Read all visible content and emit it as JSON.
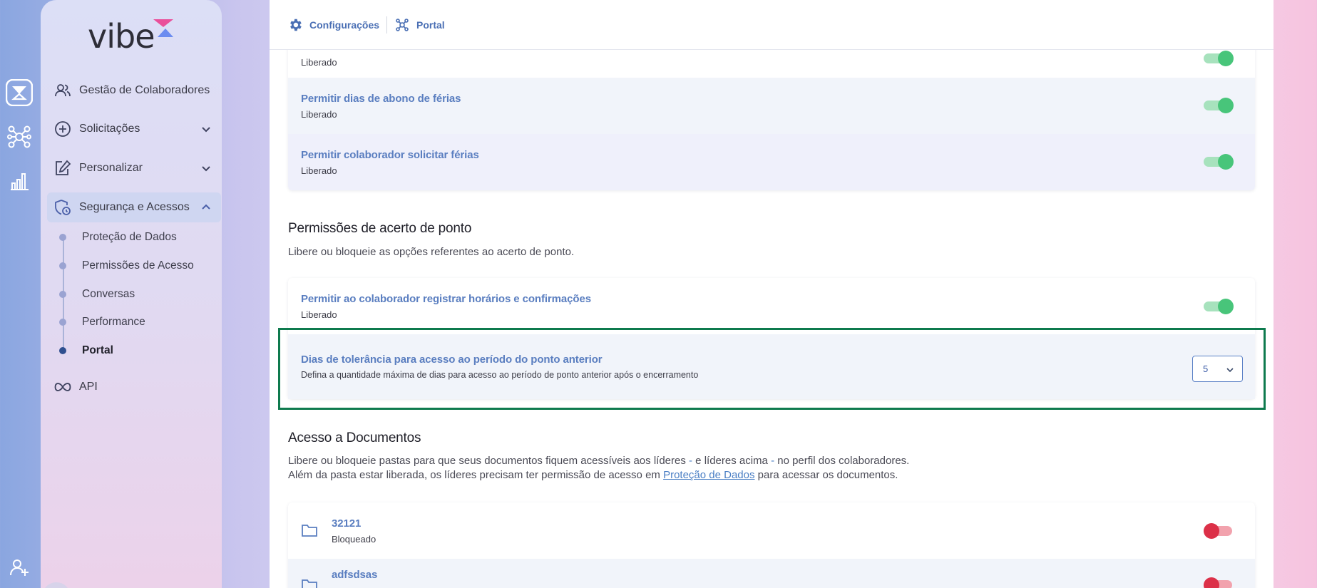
{
  "rail": {
    "icons": [
      "hourglass-icon",
      "network-icon",
      "bar-chart-icon",
      "add-user-icon"
    ]
  },
  "brand": {
    "logo_text": "vibe"
  },
  "sidebar": {
    "items": [
      {
        "label": "Gestão de Colaboradores",
        "icon": "users-icon"
      },
      {
        "label": "Solicitações",
        "icon": "plus-circle-icon",
        "expandable": true
      },
      {
        "label": "Personalizar",
        "icon": "edit-icon",
        "expandable": true
      },
      {
        "label": "Segurança e Acessos",
        "icon": "shield-icon",
        "expanded": true
      },
      {
        "label": "API",
        "icon": "infinity-icon"
      }
    ],
    "subitems": [
      {
        "label": "Proteção de Dados"
      },
      {
        "label": "Permissões de Acesso"
      },
      {
        "label": "Conversas"
      },
      {
        "label": "Performance"
      },
      {
        "label": "Portal",
        "current": true
      }
    ]
  },
  "breadcrumb": {
    "items": [
      {
        "label": "Configurações",
        "icon": "gear-icon"
      },
      {
        "label": "Portal",
        "icon": "network-icon"
      }
    ]
  },
  "vacation_permissions": {
    "rows": [
      {
        "title": "",
        "status": "Liberado",
        "enabled": true
      },
      {
        "title": "Permitir dias de abono de férias",
        "status": "Liberado",
        "enabled": true
      },
      {
        "title": "Permitir colaborador solicitar férias",
        "status": "Liberado",
        "enabled": true
      }
    ]
  },
  "time_adjust": {
    "title": "Permissões de acerto de ponto",
    "description": "Libere ou bloqueie as opções referentes ao acerto de ponto.",
    "register_row": {
      "title": "Permitir ao colaborador registrar horários e confirmações",
      "status": "Liberado",
      "enabled": true
    },
    "tolerance_row": {
      "title": "Dias de tolerância para acesso ao período do ponto anterior",
      "description": "Defina a quantidade máxima de dias para acesso ao período de ponto anterior após o encerramento",
      "selected_value": "5"
    }
  },
  "documents": {
    "title": "Acesso a Documentos",
    "description_line1_a": "Libere ou bloqueie pastas para que seus documentos fiquem acessíveis aos líderes ",
    "description_line1_dash1": "-",
    "description_line1_b": " e líderes acima ",
    "description_line1_dash2": "-",
    "description_line1_c": " no perfil dos colaboradores.",
    "description_line2_a": "Além da pasta estar liberada, os líderes precisam ter permissão de acesso em ",
    "description_line2_link": "Proteção de Dados",
    "description_line2_b": " para acessar os documentos.",
    "folders": [
      {
        "name": "32121",
        "status": "Bloqueado",
        "enabled": false
      },
      {
        "name": "adfsdsas",
        "status": "",
        "enabled": false
      }
    ]
  },
  "colors": {
    "accent": "#5a7ec0",
    "toggle_on": "#48c57a",
    "toggle_off": "#dc3048",
    "highlight": "#0e7a4e"
  }
}
